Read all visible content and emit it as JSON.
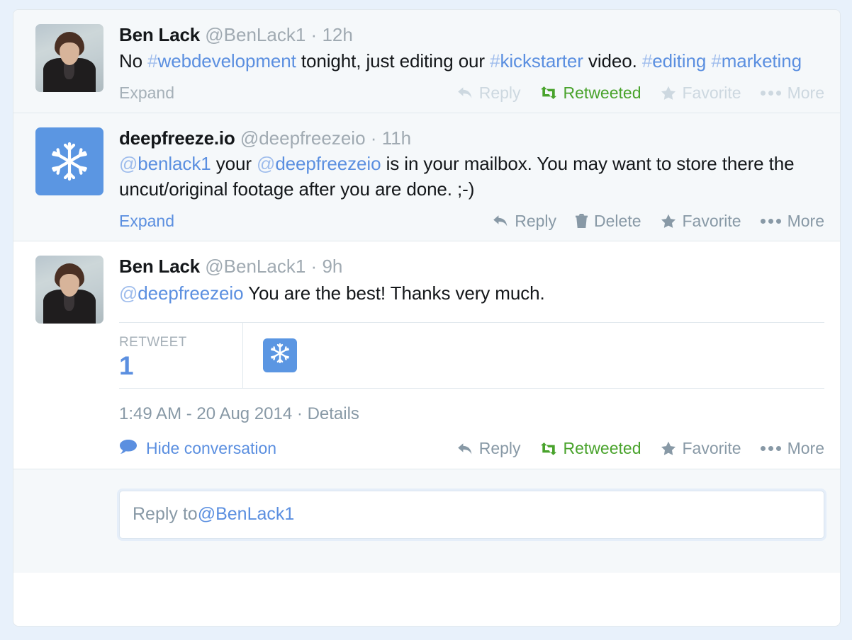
{
  "page": {
    "background_color": "#e8f1fb",
    "container_background": "#ffffff",
    "accent_blue": "#5b8fe0",
    "retweet_green": "#49a32c",
    "muted_gray": "#8899a6"
  },
  "tweets": [
    {
      "id": "tweet-1",
      "kind": "ancestor",
      "avatar": "ben-lack-photo-avatar",
      "fullname": "Ben Lack",
      "username": "@BenLack1",
      "separator": "·",
      "timestamp": "12h",
      "text_parts": [
        {
          "type": "text",
          "value": "No "
        },
        {
          "type": "hashtag",
          "symbol": "#",
          "value": "webdevelopment"
        },
        {
          "type": "text",
          "value": " tonight, just editing our "
        },
        {
          "type": "hashtag",
          "symbol": "#",
          "value": "kickstarter"
        },
        {
          "type": "text",
          "value": " video. "
        },
        {
          "type": "hashtag",
          "symbol": "#",
          "value": "editing"
        },
        {
          "type": "text",
          "value": " "
        },
        {
          "type": "hashtag",
          "symbol": "#",
          "value": "marketing"
        }
      ],
      "expand_label": "Expand",
      "expand_style": "gray",
      "actions": [
        {
          "name": "reply",
          "label": "Reply",
          "icon": "reply-arrow-icon",
          "style": "faded"
        },
        {
          "name": "retweet",
          "label": "Retweeted",
          "icon": "retweet-icon",
          "style": "green"
        },
        {
          "name": "favorite",
          "label": "Favorite",
          "icon": "star-icon",
          "style": "faded"
        },
        {
          "name": "more",
          "label": "More",
          "icon": "ellipsis-icon",
          "style": "faded"
        }
      ]
    },
    {
      "id": "tweet-2",
      "kind": "ancestor",
      "avatar": "deepfreeze-snowflake-avatar",
      "fullname": "deepfreeze.io",
      "username": "@deepfreezeio",
      "separator": "·",
      "timestamp": "11h",
      "text_parts": [
        {
          "type": "mention",
          "symbol": "@",
          "value": "benlack1"
        },
        {
          "type": "text",
          "value": " your "
        },
        {
          "type": "mention",
          "symbol": "@",
          "value": "deepfreezeio"
        },
        {
          "type": "text",
          "value": " is in your mailbox. You may want to store there the uncut/original footage after you are done. ;-)"
        }
      ],
      "expand_label": "Expand",
      "expand_style": "blue",
      "actions": [
        {
          "name": "reply",
          "label": "Reply",
          "icon": "reply-arrow-icon",
          "style": "normal"
        },
        {
          "name": "delete",
          "label": "Delete",
          "icon": "trash-icon",
          "style": "normal"
        },
        {
          "name": "favorite",
          "label": "Favorite",
          "icon": "star-icon",
          "style": "normal"
        },
        {
          "name": "more",
          "label": "More",
          "icon": "ellipsis-icon",
          "style": "normal"
        }
      ]
    },
    {
      "id": "tweet-3",
      "kind": "focus",
      "avatar": "ben-lack-photo-avatar",
      "fullname": "Ben Lack",
      "username": "@BenLack1",
      "separator": "·",
      "timestamp": "9h",
      "text_parts": [
        {
          "type": "mention",
          "symbol": "@",
          "value": "deepfreezeio"
        },
        {
          "type": "text",
          "value": " You are the best! Thanks very much."
        }
      ],
      "stats": {
        "label": "RETWEET",
        "value": "1",
        "retweeter_avatar": "deepfreeze-snowflake-mini-avatar"
      },
      "meta": {
        "time": "1:49 AM",
        "dash": "-",
        "date": "20 Aug 2014",
        "separator": "·",
        "details_label": "Details"
      },
      "hide_conversation": {
        "icon": "speech-bubble-icon",
        "label": "Hide conversation"
      },
      "actions": [
        {
          "name": "reply",
          "label": "Reply",
          "icon": "reply-arrow-icon",
          "style": "normal"
        },
        {
          "name": "retweet",
          "label": "Retweeted",
          "icon": "retweet-icon",
          "style": "green"
        },
        {
          "name": "favorite",
          "label": "Favorite",
          "icon": "star-icon",
          "style": "normal"
        },
        {
          "name": "more",
          "label": "More",
          "icon": "ellipsis-icon",
          "style": "normal"
        }
      ]
    }
  ],
  "composer": {
    "prefix": "Reply to ",
    "handle": "@BenLack1",
    "placeholder": "Reply to @BenLack1"
  }
}
